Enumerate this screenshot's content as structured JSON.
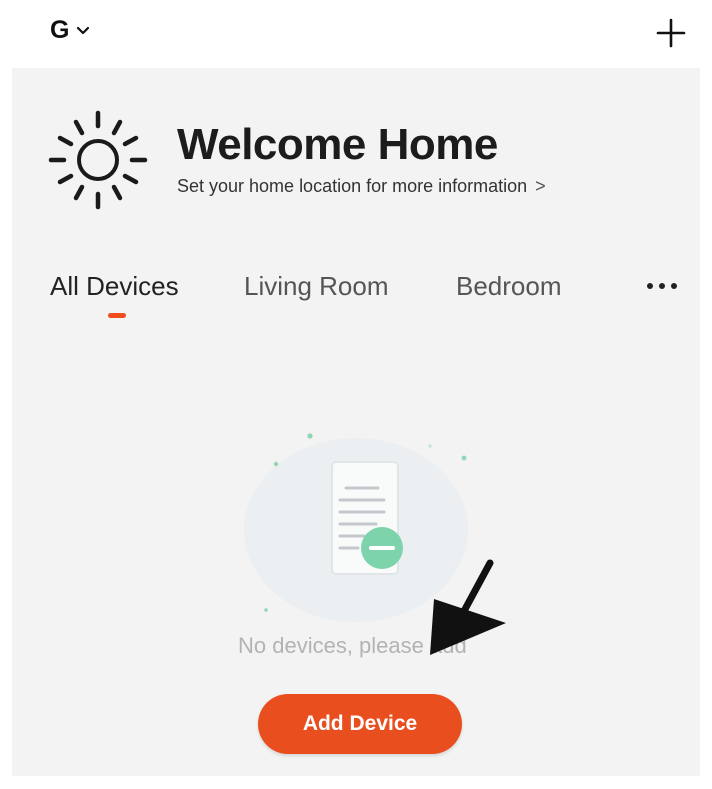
{
  "header": {
    "home_name": "G",
    "home_dropdown_icon": "chevron-down-icon",
    "add_icon": "plus-icon"
  },
  "welcome": {
    "icon": "sun-icon",
    "title": "Welcome Home",
    "subtitle": "Set your home location for more information",
    "subtitle_arrow": ">"
  },
  "tabs": {
    "items": [
      {
        "label": "All Devices",
        "active": true
      },
      {
        "label": "Living Room",
        "active": false
      },
      {
        "label": "Bedroom",
        "active": false
      }
    ],
    "more_icon": "more-horizontal-icon"
  },
  "empty_state": {
    "illustration": "empty-document-icon",
    "message": "No devices, please add",
    "button_label": "Add Device"
  },
  "colors": {
    "accent": "#e94e1f",
    "panel_bg": "#f3f3f3",
    "illustration_green": "#7dd4ac"
  }
}
